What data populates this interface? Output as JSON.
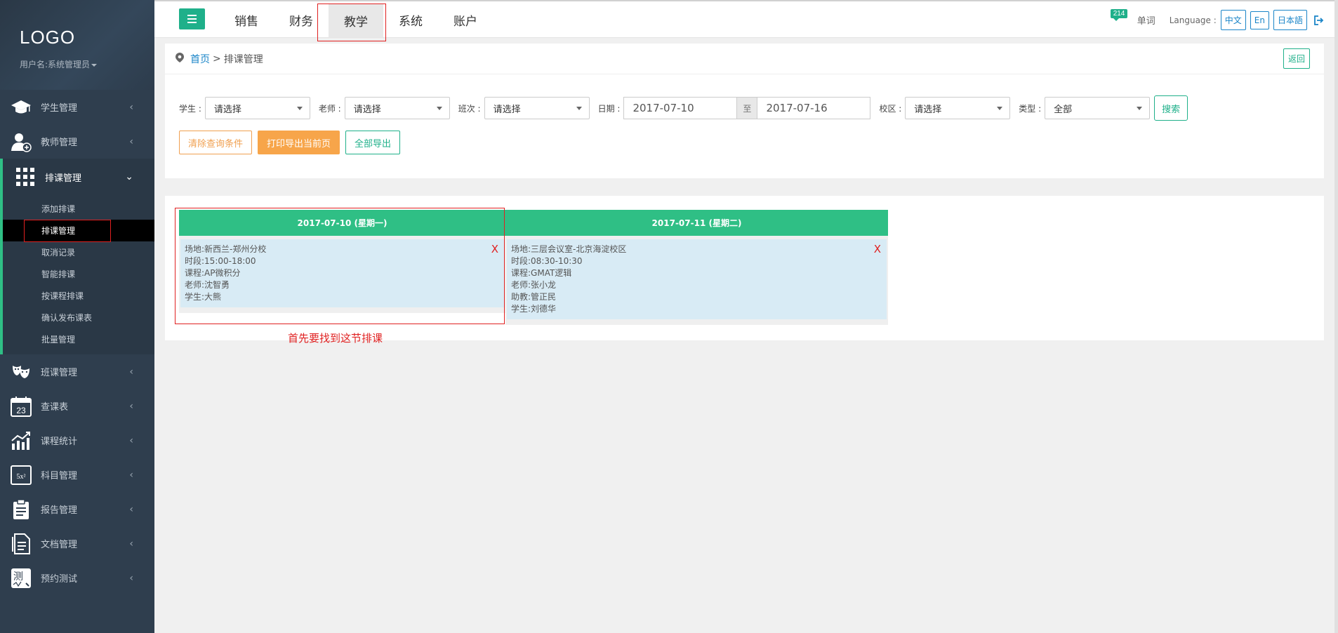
{
  "sidebar": {
    "logo": "LOGO",
    "username": "用户名:系统管理员",
    "items": [
      {
        "label": "学生管理",
        "icon": "graduation-cap-icon"
      },
      {
        "label": "教师管理",
        "icon": "teacher-icon"
      },
      {
        "label": "排课管理",
        "icon": "grid-icon"
      },
      {
        "label": "班课管理",
        "icon": "theater-masks-icon"
      },
      {
        "label": "查课表",
        "icon": "calendar-icon"
      },
      {
        "label": "课程统计",
        "icon": "chart-icon"
      },
      {
        "label": "科目管理",
        "icon": "formula-board-icon"
      },
      {
        "label": "报告管理",
        "icon": "clipboard-icon"
      },
      {
        "label": "文档管理",
        "icon": "document-icon"
      },
      {
        "label": "预约测试",
        "icon": "test-icon"
      }
    ],
    "sub_items": [
      "添加排课",
      "排课管理",
      "取消记录",
      "智能排课",
      "按课程排课",
      "确认发布课表",
      "批量管理"
    ],
    "active_sub": "排课管理"
  },
  "topbar": {
    "tabs": [
      "销售",
      "财务",
      "教学",
      "系统",
      "账户"
    ],
    "active_tab": "教学",
    "message_count": "214",
    "words_label": "单词",
    "language_label": "Language :",
    "languages": [
      "中文",
      "En",
      "日本語"
    ]
  },
  "breadcrumb": {
    "home": "首页",
    "separator": ">",
    "current": "排课管理",
    "back_label": "返回"
  },
  "filters": {
    "student_label": "学生 :",
    "student_value": "请选择",
    "teacher_label": "老师 :",
    "teacher_value": "请选择",
    "class_label": "班次 :",
    "class_value": "请选择",
    "date_label": "日期 :",
    "date_from": "2017-07-10",
    "date_sep": "至",
    "date_to": "2017-07-16",
    "campus_label": "校区 :",
    "campus_value": "请选择",
    "type_label": "类型 :",
    "type_value": "全部",
    "search_label": "搜索",
    "clear_label": "清除查询条件",
    "print_label": "打印导出当前页",
    "export_label": "全部导出"
  },
  "schedule": {
    "days": [
      {
        "header": "2017-07-10 (星期一)",
        "lesson": [
          "场地:新西兰-郑州分校",
          "时段:15:00-18:00",
          "课程:AP微积分",
          "老师:沈智勇",
          "学生:大熊"
        ]
      },
      {
        "header": "2017-07-11 (星期二)",
        "lesson": [
          "场地:三层会议室-北京海淀校区",
          "时段:08:30-10:30",
          "课程:GMAT逻辑",
          "老师:张小龙",
          "助教:管正民",
          "学生:刘德华"
        ]
      }
    ],
    "delete_label": "X",
    "note": "首先要找到这节排课"
  },
  "colors": {
    "accent": "#2fbf85",
    "sidebar_bg": "#2f3e4e",
    "annotation": "#e02020",
    "orange": "#f7a54a"
  }
}
